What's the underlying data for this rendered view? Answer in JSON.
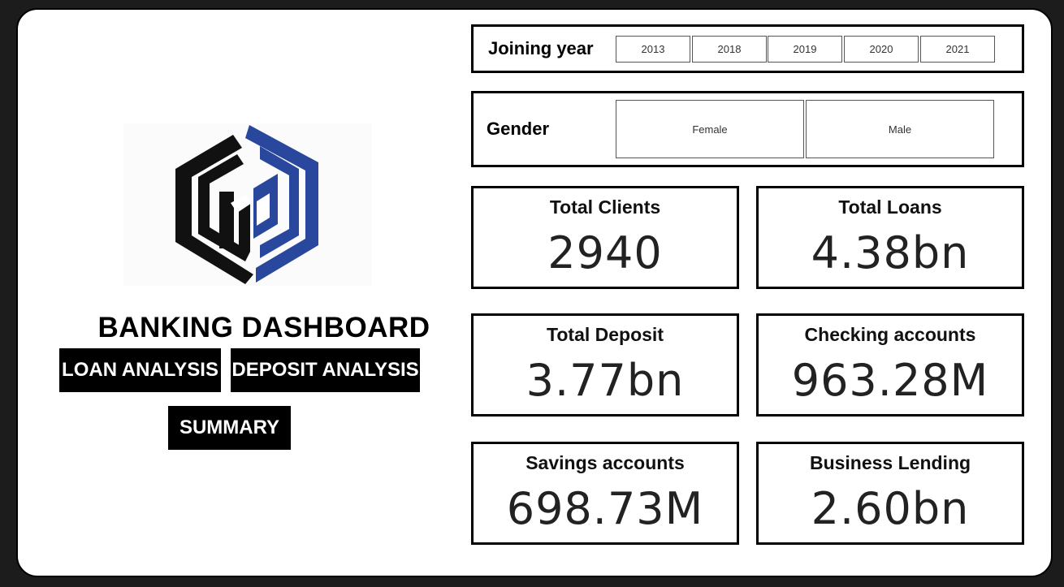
{
  "dashboard": {
    "title": "BANKING DASHBOARD",
    "nav": {
      "loan_label": "LOAN ANALYSIS",
      "deposit_label": "DEPOSIT ANALYSIS",
      "summary_label": "SUMMARY"
    }
  },
  "logo": {
    "icon": "hexagon-bank-logo",
    "colors": {
      "dark": "#111111",
      "blue": "#2a479e"
    }
  },
  "filters": {
    "joining_year": {
      "label": "Joining year",
      "options": [
        "2013",
        "2018",
        "2019",
        "2020",
        "2021"
      ]
    },
    "gender": {
      "label": "Gender",
      "options": [
        "Female",
        "Male"
      ]
    }
  },
  "kpis": {
    "total_clients": {
      "label": "Total Clients",
      "value": "2940"
    },
    "total_loans": {
      "label": "Total Loans",
      "value": "4.38bn"
    },
    "total_deposit": {
      "label": "Total Deposit",
      "value": "3.77bn"
    },
    "checking_accounts": {
      "label": "Checking accounts",
      "value": "963.28M"
    },
    "savings_accounts": {
      "label": "Savings accounts",
      "value": "698.73M"
    },
    "business_lending": {
      "label": "Business Lending",
      "value": "2.60bn"
    }
  }
}
